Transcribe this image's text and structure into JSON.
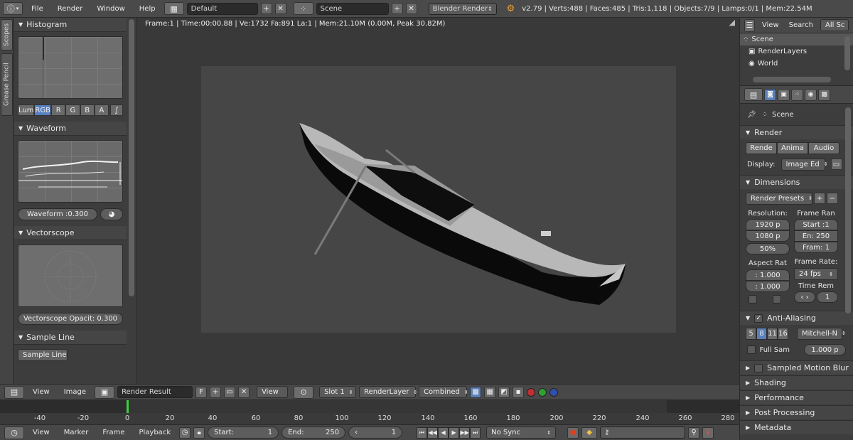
{
  "topbar": {
    "menus": [
      "File",
      "Render",
      "Window",
      "Help"
    ],
    "layout": "Default",
    "scene": "Scene",
    "engine": "Blender Render",
    "stats": "v2.79 | Verts:488 | Faces:485 | Tris:1,118 | Objects:7/9 | Lamps:0/1 | Mem:22.54M"
  },
  "left": {
    "tabs": [
      "Scopes",
      "Grease Pencil"
    ],
    "histogram": {
      "title": "Histogram",
      "channels": [
        "Lum",
        "RGB",
        "R",
        "G",
        "B",
        "A"
      ],
      "active_channel": "RGB"
    },
    "waveform": {
      "title": "Waveform",
      "opacity_label": "Waveform :0.300"
    },
    "vectorscope": {
      "title": "Vectorscope",
      "opacity_label": "Vectorscope Opacit: 0.300"
    },
    "sample_line": {
      "title": "Sample Line",
      "button": "Sample Line"
    }
  },
  "viewport": {
    "info": "Frame:1 | Time:00:00.88 | Ve:1732 Fa:891 La:1 | Mem:21.10M (0.00M, Peak 30.82M)"
  },
  "image_header": {
    "view": "View",
    "image": "Image",
    "image_name": "Render Result",
    "fake_user": "F",
    "view2": "View",
    "slot": "Slot 1",
    "layer": "RenderLayer",
    "pass": "Combined"
  },
  "timeline": {
    "ticks": [
      "-40",
      "-20",
      "0",
      "20",
      "40",
      "60",
      "80",
      "100",
      "120",
      "140",
      "160",
      "180",
      "200",
      "220",
      "240",
      "260",
      "280"
    ],
    "view": "View",
    "marker": "Marker",
    "frame": "Frame",
    "playback": "Playback",
    "start_label": "Start:",
    "start_value": "1",
    "end_label": "End:",
    "end_value": "250",
    "current": "1",
    "sync": "No Sync"
  },
  "outliner": {
    "view": "View",
    "search": "Search",
    "filter": "All Sc",
    "items": [
      "Scene",
      "RenderLayers",
      "World"
    ]
  },
  "properties": {
    "context": "Scene",
    "render_title": "Render",
    "render_buttons": [
      "Rende",
      "Anima",
      "Audio"
    ],
    "display_label": "Display:",
    "display_value": "Image Ed",
    "dimensions_title": "Dimensions",
    "presets": "Render Presets",
    "resolution_label": "Resolution:",
    "res_x": "1920 p",
    "res_y": "1080 p",
    "res_pct": "50%",
    "frame_range_label": "Frame Ran",
    "frame_start": "Start :1",
    "frame_end": "En: 250",
    "frame_step": "Fram: 1",
    "aspect_label": "Aspect Rat",
    "aspect_x": ": 1.000",
    "aspect_y": ": 1.000",
    "frame_rate_label": "Frame Rate:",
    "frame_rate": "24 fps",
    "time_remap_label": "Time Rem",
    "time_remap_value": "1",
    "aa_title": "Anti-Aliasing",
    "aa_samples": [
      "5",
      "8",
      "11",
      "16"
    ],
    "aa_active": "8",
    "aa_filter": "Mitchell-N",
    "full_sample": "Full Sam",
    "filter_size": "1.000 p",
    "collapsed_sections": [
      "Sampled Motion Blur",
      "Shading",
      "Performance",
      "Post Processing",
      "Metadata"
    ]
  }
}
